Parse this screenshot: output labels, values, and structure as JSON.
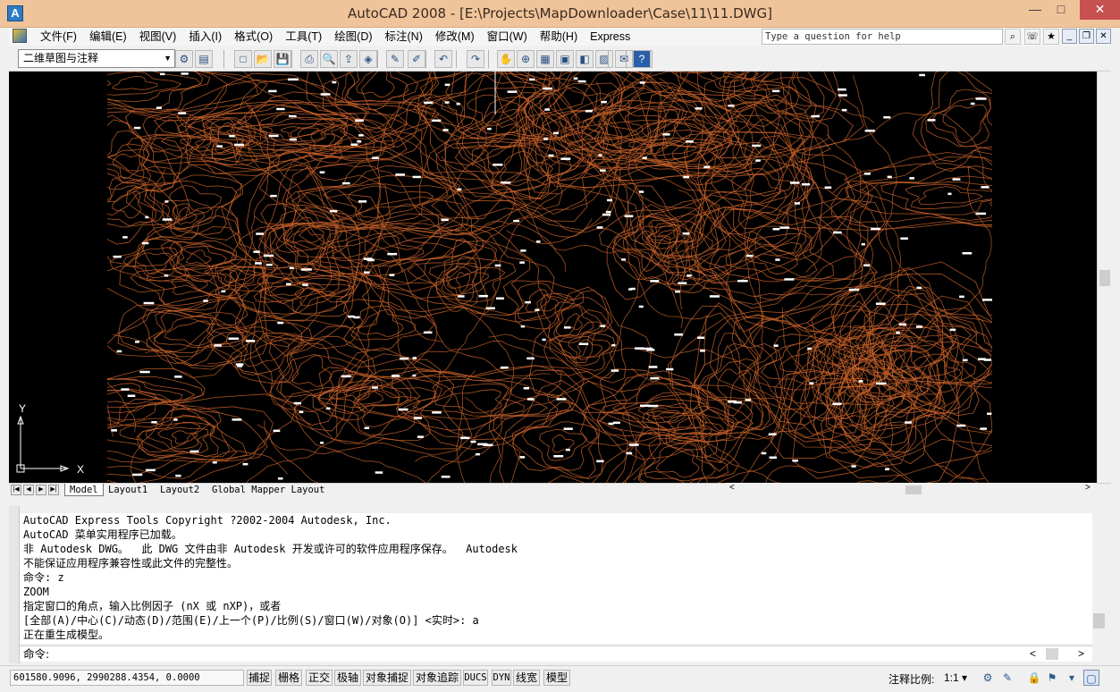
{
  "window": {
    "title": "AutoCAD 2008 - [E:\\Projects\\MapDownloader\\Case\\11\\11.DWG]",
    "min_glyph": "—",
    "max_glyph": "□",
    "close_glyph": "✕"
  },
  "menu": {
    "items": [
      "文件(F)",
      "编辑(E)",
      "视图(V)",
      "插入(I)",
      "格式(O)",
      "工具(T)",
      "绘图(D)",
      "标注(N)",
      "修改(M)",
      "窗口(W)",
      "帮助(H)",
      "Express"
    ],
    "help_placeholder": "Type a question for help"
  },
  "toolbar": {
    "workspace": "二维草图与注释",
    "icons": [
      "workspace-settings-icon",
      "my-workspace-icon",
      "qnew-icon",
      "open-icon",
      "save-icon",
      "plot-icon",
      "plot-preview-icon",
      "publish-icon",
      "3d-dwf-icon",
      "match-properties-icon",
      "block-editor-icon",
      "undo-icon",
      "redo-icon",
      "pan-icon",
      "zoom-realtime-icon",
      "properties-icon",
      "design-center-icon",
      "tool-palettes-icon",
      "sheet-set-icon",
      "markup-icon",
      "quickcalc-icon",
      "help-icon"
    ]
  },
  "ucs": {
    "x_label": "X",
    "y_label": "Y"
  },
  "layout_tabs": [
    "Model",
    "Layout1",
    "Layout2",
    "Global Mapper Layout"
  ],
  "command_history": [
    "AutoCAD Express Tools Copyright ?2002-2004 Autodesk, Inc.",
    "AutoCAD 菜单实用程序已加载。",
    "非 Autodesk DWG。  此 DWG 文件由非 Autodesk 开发或许可的软件应用程序保存。  Autodesk",
    "不能保证应用程序兼容性或此文件的完整性。",
    "命令: z",
    "ZOOM",
    "指定窗口的角点，输入比例因子 (nX 或 nXP)，或者",
    "[全部(A)/中心(C)/动态(D)/范围(E)/上一个(P)/比例(S)/窗口(W)/对象(O)] <实时>: a",
    "正在重生成模型。"
  ],
  "command_prompt": "命令:",
  "status": {
    "coordinates": "601580.9096, 2990288.4354, 0.0000",
    "toggles": [
      "捕捉",
      "栅格",
      "正交",
      "极轴",
      "对象捕捉",
      "对象追踪",
      "DUCS",
      "DYN",
      "线宽",
      "模型"
    ],
    "annotation_scale_label": "注释比例:",
    "annotation_scale_value": "1:1 ▾"
  },
  "colors": {
    "title_bar": "#f0c49a",
    "canvas_bg": "#000000",
    "contour": "#c8622a",
    "label": "#ffffff",
    "close_button": "#c75050"
  }
}
